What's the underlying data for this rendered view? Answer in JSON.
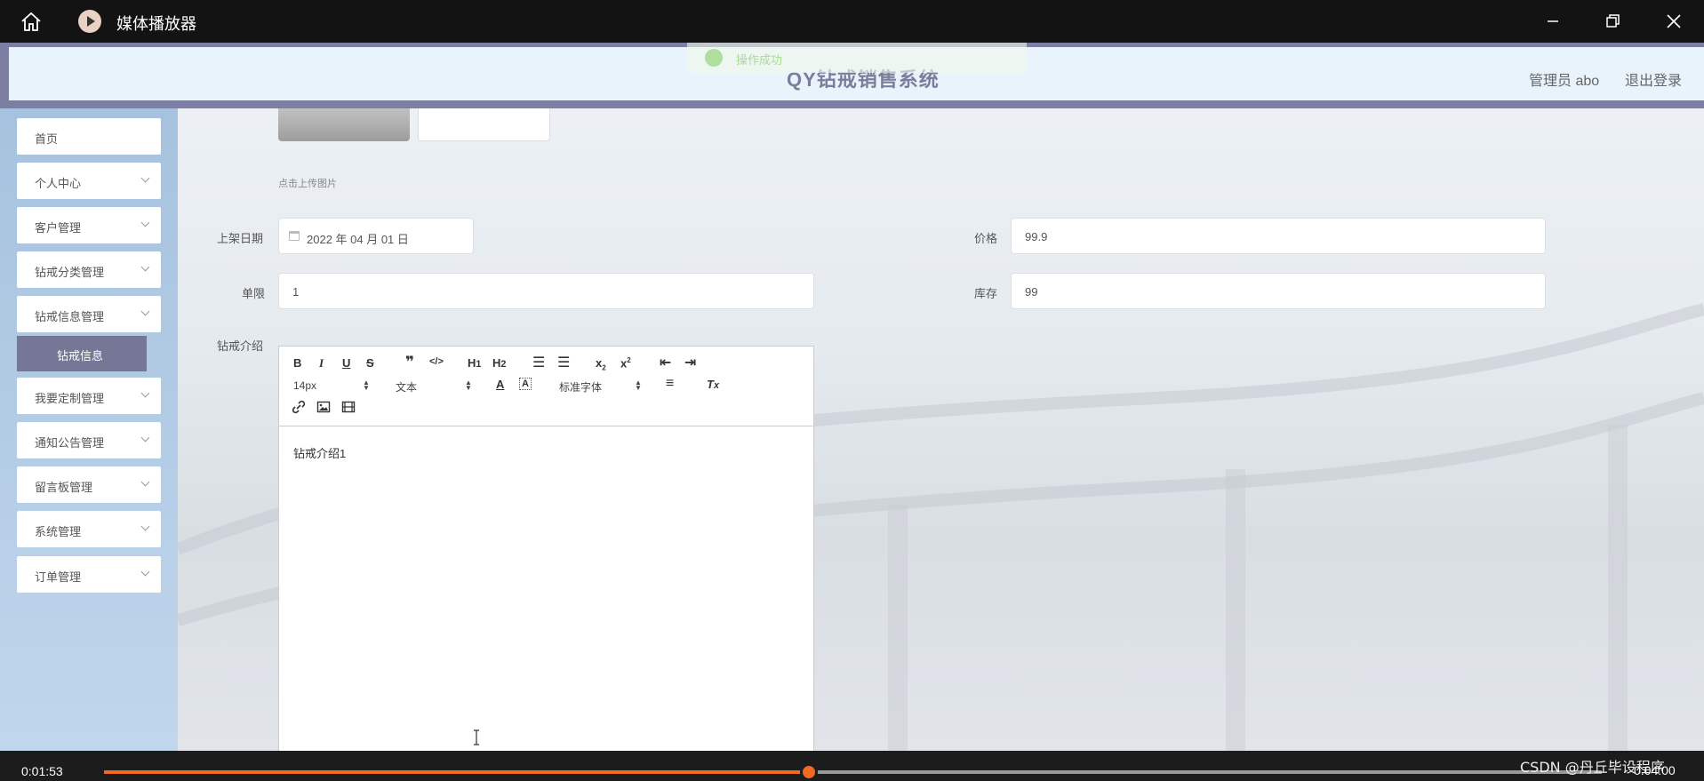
{
  "player": {
    "title": "媒体播放器",
    "current_time": "0:01:53",
    "total_time": "0:04:00",
    "progress_fraction": 0.4708,
    "watermark": "CSDN @丹丘毕设程序",
    "accent_color": "#f06a22"
  },
  "header": {
    "title": "QY钻戒销售系统",
    "admin_label": "管理员 abo",
    "logout_label": "退出登录"
  },
  "toast": {
    "text": "操作成功"
  },
  "sidebar": {
    "items": [
      {
        "label": "首页"
      },
      {
        "label": "个人中心"
      },
      {
        "label": "客户管理"
      },
      {
        "label": "钻戒分类管理"
      },
      {
        "label": "钻戒信息管理"
      },
      {
        "label": "我要定制管理"
      },
      {
        "label": "通知公告管理"
      },
      {
        "label": "留言板管理"
      },
      {
        "label": "系统管理"
      },
      {
        "label": "订单管理"
      }
    ],
    "active_sub": "钻戒信息"
  },
  "form": {
    "upload_hint": "点击上传图片",
    "shelf_date_label": "上架日期",
    "shelf_date_value": "2022 年 04 月 01 日",
    "price_label": "价格",
    "price_value": "99.9",
    "limit_label": "单限",
    "limit_value": "1",
    "stock_label": "库存",
    "stock_value": "99",
    "intro_label": "钻戒介绍"
  },
  "editor": {
    "size_select": "14px",
    "para_select": "文本",
    "font_select": "标准字体",
    "content": "钻戒介绍1"
  }
}
